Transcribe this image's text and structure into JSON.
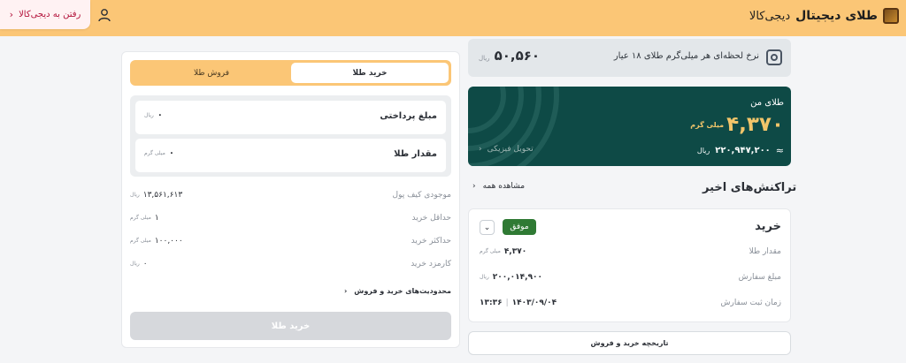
{
  "header": {
    "brand_bold": "طلای دیجیتال",
    "brand_normal": "دیجی‌کالا",
    "go_button": "رفتن به دیجی‌کالا",
    "go_chevron": "‹",
    "bg_color": "#fbc676"
  },
  "rate": {
    "label": "نرخ لحظه‌ای هر میلی‌گرم طلای ۱۸ عیار",
    "value": "۵۰,۵۶۰",
    "unit": "ریال"
  },
  "gold": {
    "title": "طلای من",
    "amount": "۴,۳۷۰",
    "amount_unit": "میلی گرم",
    "approx": "≈",
    "rial_value": "۲۲۰,۹۴۷,۲۰۰",
    "rial_unit": "ریال",
    "delivery": "تحویل فیزیکی",
    "delivery_chevron": "‹",
    "card_color": "#0e4a46",
    "accent_color": "#f2c56a"
  },
  "recent": {
    "title": "تراکنش‌های اخیر",
    "see_all": "مشاهده همه",
    "see_all_chevron": "‹"
  },
  "transaction": {
    "type": "خرید",
    "status": "موفق",
    "toggle": "⌄",
    "rows": [
      {
        "label": "مقدار طلا",
        "value": "۴,۳۷۰",
        "unit": "میلی گرم"
      },
      {
        "label": "مبلغ سفارش",
        "value": "۲۰۰,۰۱۴,۹۰۰",
        "unit": "ریال"
      },
      {
        "label": "زمان ثبت سفارش",
        "date": "۱۴۰۳/۰۹/۰۴",
        "sep": "|",
        "time": "۱۳:۳۶"
      }
    ],
    "status_color": "#2f7a34"
  },
  "history_button": "تاریخچه خرید و فروش",
  "trade": {
    "tabs": {
      "buy": "خرید طلا",
      "sell": "فروش طلا"
    },
    "payment": {
      "label": "مبلغ پرداختی",
      "value": "۰",
      "unit": "ریال"
    },
    "amount": {
      "label": "مقدار طلا",
      "value": "۰",
      "unit": "میلی گرم"
    },
    "info": [
      {
        "label": "موجودی کیف پول",
        "value": "۱۳,۵۶۱,۶۱۳",
        "unit": "ریال"
      },
      {
        "label": "حداقل خرید",
        "value": "۱",
        "unit": "میلی گرم"
      },
      {
        "label": "حداکثر خرید",
        "value": "۱۰۰,۰۰۰",
        "unit": "میلی گرم"
      },
      {
        "label": "کارمزد خرید",
        "value": "۰",
        "unit": "ریال"
      }
    ],
    "limits_link": "محدودیت‌های خرید و فروش",
    "limits_chevron": "‹",
    "buy_button": "خرید طلا"
  }
}
